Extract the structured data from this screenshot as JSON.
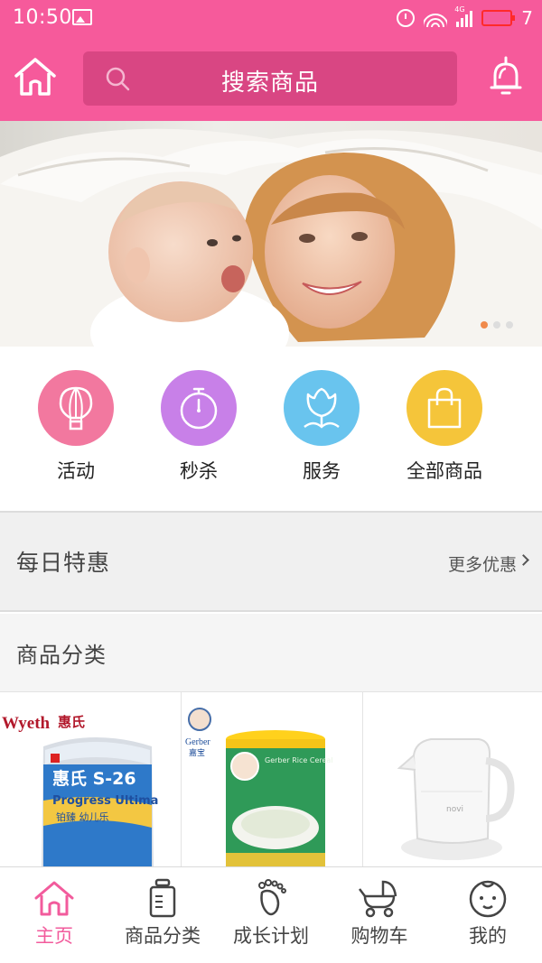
{
  "status_bar": {
    "time": "10:50",
    "battery": "7",
    "network": "4G"
  },
  "header": {
    "search_placeholder": "搜索商品"
  },
  "banner": {
    "slide_count": 3,
    "active_slide": 1
  },
  "quick_nav": [
    {
      "label": "活动",
      "icon": "hot-air-balloon-icon",
      "color": "#f2789f"
    },
    {
      "label": "秒杀",
      "icon": "stopwatch-icon",
      "color": "#c880e8"
    },
    {
      "label": "服务",
      "icon": "tulip-icon",
      "color": "#69c4ee"
    },
    {
      "label": "全部商品",
      "icon": "shopping-bag-icon",
      "color": "#f5c53a"
    }
  ],
  "daily_deals": {
    "title": "每日特惠",
    "more": "更多优惠"
  },
  "categories": {
    "title": "商品分类",
    "products": [
      {
        "brand": "Wyeth",
        "brand_cn": "惠氏",
        "name": "惠氏 S-26",
        "subtitle": "Progress Ultima",
        "subtitle_cn": "铂臻 幼儿乐"
      },
      {
        "brand": "Gerber",
        "brand_cn": "嘉宝",
        "name": "Gerber Rice Cereal"
      },
      {
        "brand": "novi",
        "name": "electric kettle"
      }
    ]
  },
  "tabbar": [
    {
      "label": "主页",
      "icon": "home-icon",
      "active": true
    },
    {
      "label": "商品分类",
      "icon": "baby-bottle-icon",
      "active": false
    },
    {
      "label": "成长计划",
      "icon": "footprint-icon",
      "active": false
    },
    {
      "label": "购物车",
      "icon": "stroller-icon",
      "active": false
    },
    {
      "label": "我的",
      "icon": "baby-face-icon",
      "active": false
    }
  ],
  "colors": {
    "brand_pink": "#f65a9b",
    "search_bg": "#d94683",
    "active_tab": "#f25b9c"
  }
}
